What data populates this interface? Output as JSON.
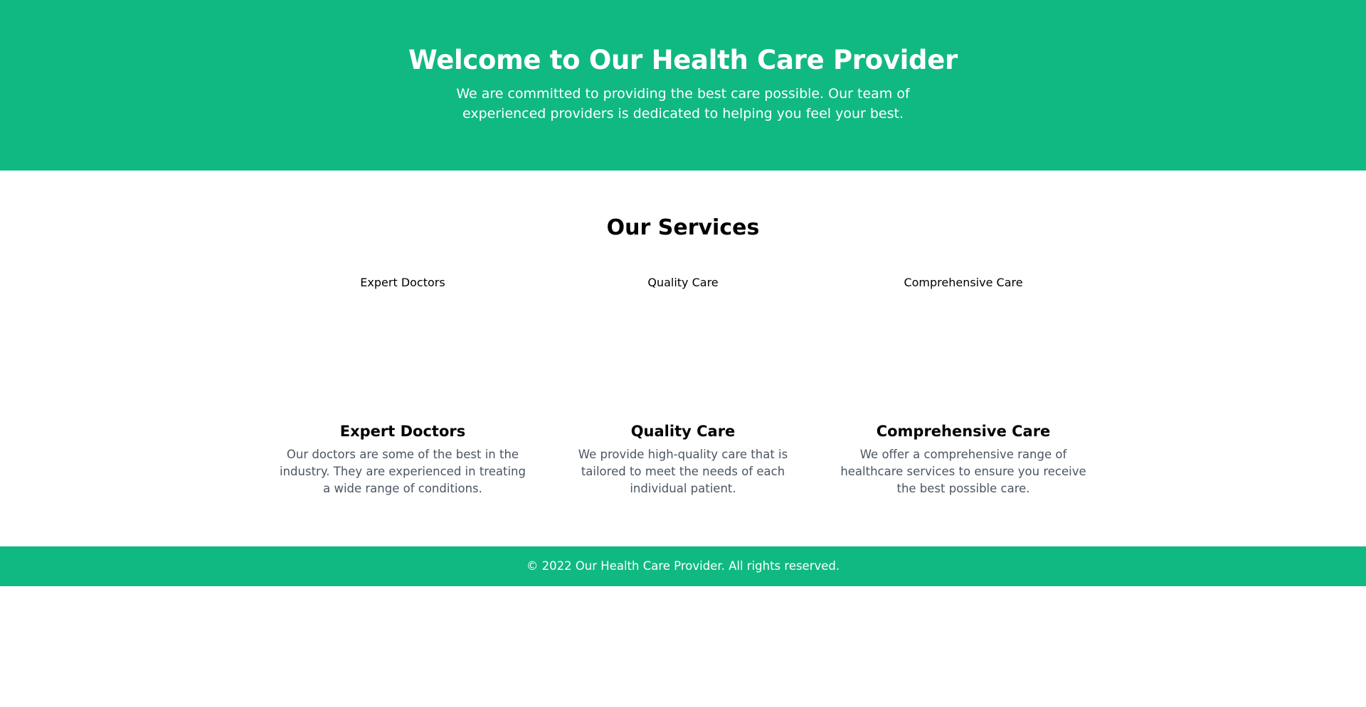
{
  "hero": {
    "title": "Welcome to Our Health Care Provider",
    "subtitle": "We are committed to providing the best care possible. Our team of experienced providers is dedicated to helping you feel your best."
  },
  "services": {
    "heading": "Our Services",
    "items": [
      {
        "image_alt": "Expert Doctors",
        "title": "Expert Doctors",
        "description": "Our doctors are some of the best in the industry. They are experienced in treating a wide range of conditions."
      },
      {
        "image_alt": "Quality Care",
        "title": "Quality Care",
        "description": "We provide high-quality care that is tailored to meet the needs of each individual patient."
      },
      {
        "image_alt": "Comprehensive Care",
        "title": "Comprehensive Care",
        "description": "We offer a comprehensive range of healthcare services to ensure you receive the best possible care."
      }
    ]
  },
  "footer": {
    "text": "© 2022 Our Health Care Provider. All rights reserved."
  },
  "colors": {
    "brand": "#10b981",
    "text_muted": "#4b5563"
  }
}
